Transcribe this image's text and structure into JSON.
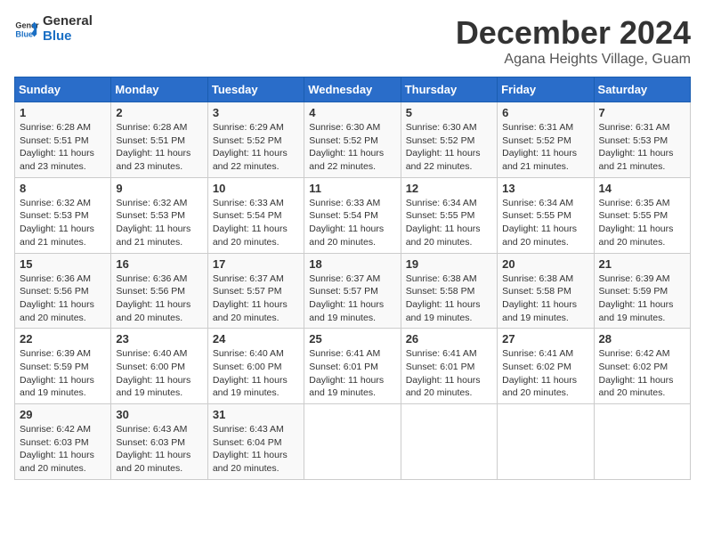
{
  "header": {
    "logo_general": "General",
    "logo_blue": "Blue",
    "month": "December 2024",
    "location": "Agana Heights Village, Guam"
  },
  "days_of_week": [
    "Sunday",
    "Monday",
    "Tuesday",
    "Wednesday",
    "Thursday",
    "Friday",
    "Saturday"
  ],
  "weeks": [
    [
      {
        "day": "1",
        "sunrise": "6:28 AM",
        "sunset": "5:51 PM",
        "daylight": "11 hours and 23 minutes."
      },
      {
        "day": "2",
        "sunrise": "6:28 AM",
        "sunset": "5:51 PM",
        "daylight": "11 hours and 23 minutes."
      },
      {
        "day": "3",
        "sunrise": "6:29 AM",
        "sunset": "5:52 PM",
        "daylight": "11 hours and 22 minutes."
      },
      {
        "day": "4",
        "sunrise": "6:30 AM",
        "sunset": "5:52 PM",
        "daylight": "11 hours and 22 minutes."
      },
      {
        "day": "5",
        "sunrise": "6:30 AM",
        "sunset": "5:52 PM",
        "daylight": "11 hours and 22 minutes."
      },
      {
        "day": "6",
        "sunrise": "6:31 AM",
        "sunset": "5:52 PM",
        "daylight": "11 hours and 21 minutes."
      },
      {
        "day": "7",
        "sunrise": "6:31 AM",
        "sunset": "5:53 PM",
        "daylight": "11 hours and 21 minutes."
      }
    ],
    [
      {
        "day": "8",
        "sunrise": "6:32 AM",
        "sunset": "5:53 PM",
        "daylight": "11 hours and 21 minutes."
      },
      {
        "day": "9",
        "sunrise": "6:32 AM",
        "sunset": "5:53 PM",
        "daylight": "11 hours and 21 minutes."
      },
      {
        "day": "10",
        "sunrise": "6:33 AM",
        "sunset": "5:54 PM",
        "daylight": "11 hours and 20 minutes."
      },
      {
        "day": "11",
        "sunrise": "6:33 AM",
        "sunset": "5:54 PM",
        "daylight": "11 hours and 20 minutes."
      },
      {
        "day": "12",
        "sunrise": "6:34 AM",
        "sunset": "5:55 PM",
        "daylight": "11 hours and 20 minutes."
      },
      {
        "day": "13",
        "sunrise": "6:34 AM",
        "sunset": "5:55 PM",
        "daylight": "11 hours and 20 minutes."
      },
      {
        "day": "14",
        "sunrise": "6:35 AM",
        "sunset": "5:55 PM",
        "daylight": "11 hours and 20 minutes."
      }
    ],
    [
      {
        "day": "15",
        "sunrise": "6:36 AM",
        "sunset": "5:56 PM",
        "daylight": "11 hours and 20 minutes."
      },
      {
        "day": "16",
        "sunrise": "6:36 AM",
        "sunset": "5:56 PM",
        "daylight": "11 hours and 20 minutes."
      },
      {
        "day": "17",
        "sunrise": "6:37 AM",
        "sunset": "5:57 PM",
        "daylight": "11 hours and 20 minutes."
      },
      {
        "day": "18",
        "sunrise": "6:37 AM",
        "sunset": "5:57 PM",
        "daylight": "11 hours and 19 minutes."
      },
      {
        "day": "19",
        "sunrise": "6:38 AM",
        "sunset": "5:58 PM",
        "daylight": "11 hours and 19 minutes."
      },
      {
        "day": "20",
        "sunrise": "6:38 AM",
        "sunset": "5:58 PM",
        "daylight": "11 hours and 19 minutes."
      },
      {
        "day": "21",
        "sunrise": "6:39 AM",
        "sunset": "5:59 PM",
        "daylight": "11 hours and 19 minutes."
      }
    ],
    [
      {
        "day": "22",
        "sunrise": "6:39 AM",
        "sunset": "5:59 PM",
        "daylight": "11 hours and 19 minutes."
      },
      {
        "day": "23",
        "sunrise": "6:40 AM",
        "sunset": "6:00 PM",
        "daylight": "11 hours and 19 minutes."
      },
      {
        "day": "24",
        "sunrise": "6:40 AM",
        "sunset": "6:00 PM",
        "daylight": "11 hours and 19 minutes."
      },
      {
        "day": "25",
        "sunrise": "6:41 AM",
        "sunset": "6:01 PM",
        "daylight": "11 hours and 19 minutes."
      },
      {
        "day": "26",
        "sunrise": "6:41 AM",
        "sunset": "6:01 PM",
        "daylight": "11 hours and 20 minutes."
      },
      {
        "day": "27",
        "sunrise": "6:41 AM",
        "sunset": "6:02 PM",
        "daylight": "11 hours and 20 minutes."
      },
      {
        "day": "28",
        "sunrise": "6:42 AM",
        "sunset": "6:02 PM",
        "daylight": "11 hours and 20 minutes."
      }
    ],
    [
      {
        "day": "29",
        "sunrise": "6:42 AM",
        "sunset": "6:03 PM",
        "daylight": "11 hours and 20 minutes."
      },
      {
        "day": "30",
        "sunrise": "6:43 AM",
        "sunset": "6:03 PM",
        "daylight": "11 hours and 20 minutes."
      },
      {
        "day": "31",
        "sunrise": "6:43 AM",
        "sunset": "6:04 PM",
        "daylight": "11 hours and 20 minutes."
      },
      null,
      null,
      null,
      null
    ]
  ],
  "labels": {
    "sunrise": "Sunrise:",
    "sunset": "Sunset:",
    "daylight": "Daylight:"
  }
}
